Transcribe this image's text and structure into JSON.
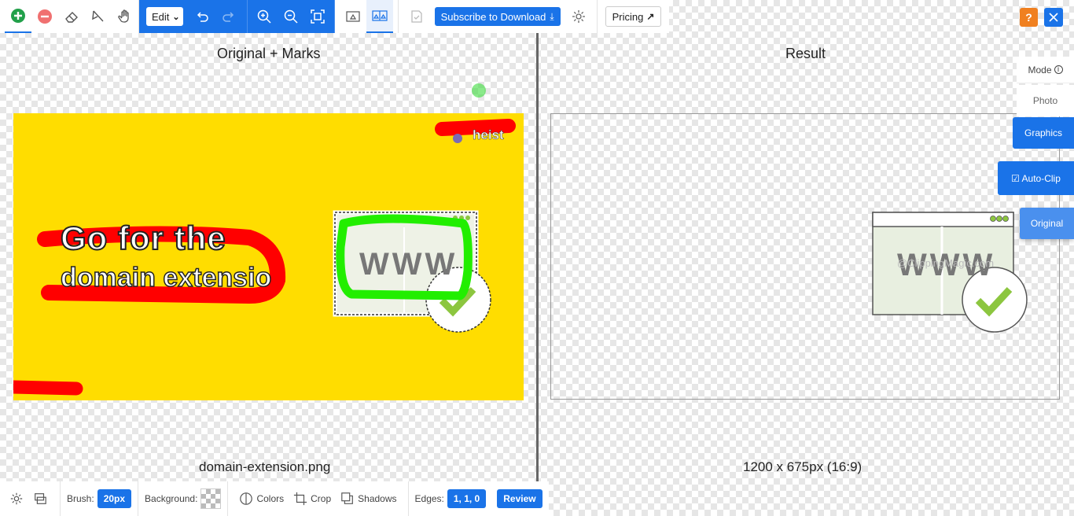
{
  "toolbar": {
    "edit_label": "Edit",
    "subscribe_label": "Subscribe to Download",
    "pricing_label": "Pricing",
    "help_label": "?"
  },
  "left_panel": {
    "title": "Original + Marks",
    "filename": "domain-extension.png",
    "image_text": {
      "line1": "Go for the",
      "line2": "domain extensio",
      "www": "WWW",
      "corner": "heist"
    }
  },
  "right_panel": {
    "title": "Result",
    "dimensions": "1200 x 675px (16:9)",
    "www": "WWW",
    "watermark": "@ClippingMagic.com"
  },
  "side_tabs": {
    "mode_label": "Mode",
    "photo_label": "Photo",
    "graphics_label": "Graphics",
    "autoclip_label": "☑ Auto-Clip",
    "original_label": "Original"
  },
  "bottombar": {
    "brush_label": "Brush:",
    "brush_value": "20px",
    "background_label": "Background:",
    "colors_label": "Colors",
    "crop_label": "Crop",
    "shadows_label": "Shadows",
    "edges_label": "Edges:",
    "edges_value": "1, 1, 0",
    "review_label": "Review"
  },
  "colors": {
    "accent": "#1a73e8",
    "image_background": "#ffdd00",
    "red_marks": "#ff0000",
    "green_marks": "#22ee00",
    "help_orange": "#f08020"
  }
}
